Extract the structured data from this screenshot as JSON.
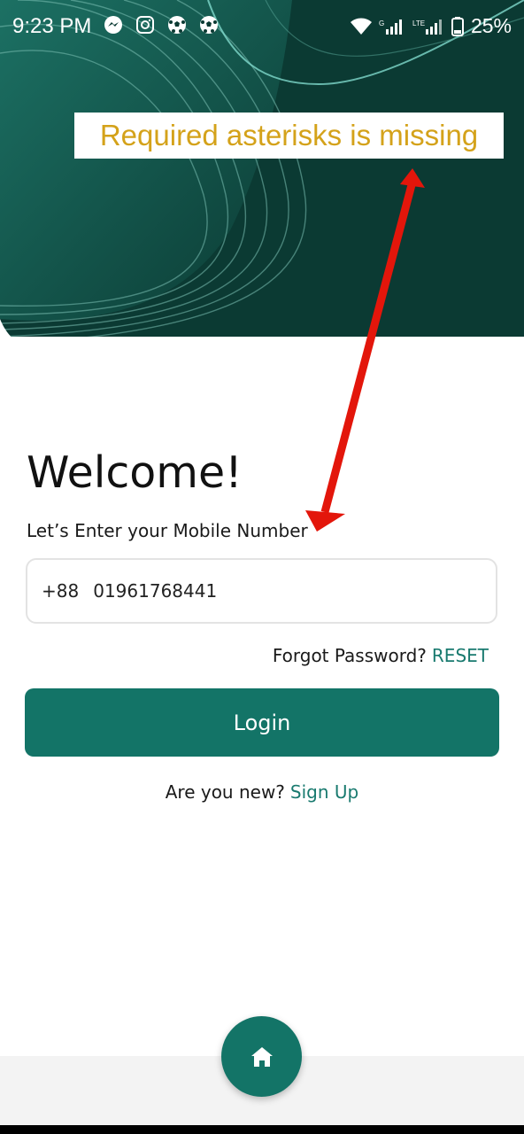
{
  "status_bar": {
    "time": "9:23 PM",
    "battery": "25%",
    "notification_icons": [
      "messenger-icon",
      "instagram-icon",
      "soccer-ball-icon",
      "soccer-ball-icon"
    ],
    "right_icons": [
      "wifi-icon",
      "signal-icon",
      "lte-signal-icon",
      "battery-icon"
    ]
  },
  "annotation": {
    "text": "Required asterisks is missing",
    "color": "#d4a21a",
    "arrow_color": "#e3160b"
  },
  "login": {
    "title": "Welcome!",
    "subtitle": "Let’s Enter your Mobile Number",
    "country_code": "+88",
    "phone_value": "01961768441",
    "forgot_text": "Forgot Password?",
    "reset_label": "RESET",
    "login_button": "Login",
    "new_user_text": "Are you new?",
    "signup_label": "Sign Up"
  },
  "colors": {
    "hero_bg": "#0b3a33",
    "accent": "#137467",
    "link": "#197a6f"
  },
  "bottom_nav": {
    "home_icon": "home-icon"
  }
}
